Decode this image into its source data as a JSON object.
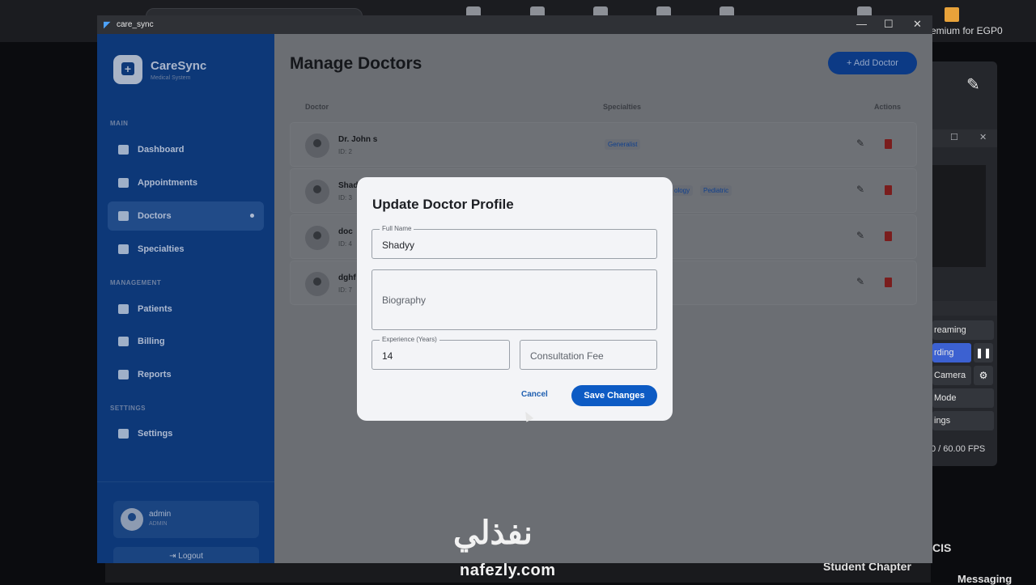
{
  "desktop": {
    "premium_text": "emium for EGP0",
    "obs": {
      "buttons": [
        "reaming",
        "rding",
        "Camera",
        "Mode",
        "ings"
      ],
      "fps": "0 / 60.00 FPS"
    },
    "cis_text": "CIS",
    "student_chapter": "Student Chapter",
    "messaging": "Messaging"
  },
  "window": {
    "title": "care_sync",
    "controls": {
      "minimize": "—",
      "maximize": "☐",
      "close": "✕"
    }
  },
  "sidebar": {
    "brand_name": "CareSync",
    "brand_sub": "Medical System",
    "section_main": "MAIN",
    "section_management": "MANAGEMENT",
    "section_settings": "SETTINGS",
    "items": [
      {
        "label": "Dashboard",
        "icon": "dashboard-icon"
      },
      {
        "label": "Appointments",
        "icon": "calendar-icon"
      },
      {
        "label": "Doctors",
        "icon": "medical-bag-icon",
        "active": true
      },
      {
        "label": "Specialties",
        "icon": "category-icon"
      },
      {
        "label": "Patients",
        "icon": "people-icon"
      },
      {
        "label": "Billing",
        "icon": "card-icon"
      },
      {
        "label": "Reports",
        "icon": "report-icon"
      },
      {
        "label": "Settings",
        "icon": "gear-icon"
      }
    ],
    "user": {
      "name": "admin",
      "role": "ADMIN"
    },
    "logout": "Logout"
  },
  "main": {
    "title": "Manage Doctors",
    "add_button": "Add Doctor",
    "columns": {
      "doctor": "Doctor",
      "specialties": "Specialties",
      "actions": "Actions"
    },
    "rows": [
      {
        "name": "Dr. John s",
        "id": "ID: 2",
        "specialties": [
          "Generalist"
        ]
      },
      {
        "name": "Shad",
        "id": "ID: 3",
        "specialties": [
          "ology",
          "Pediatric"
        ]
      },
      {
        "name": "doc",
        "id": "ID: 4",
        "specialties": []
      },
      {
        "name": "dghf",
        "id": "ID: 7",
        "specialties": []
      }
    ]
  },
  "modal": {
    "title": "Update Doctor Profile",
    "full_name_label": "Full Name",
    "full_name_value": "Shadyy",
    "biography_placeholder": "Biography",
    "experience_label": "Experience (Years)",
    "experience_value": "14",
    "fee_placeholder": "Consultation Fee",
    "cancel": "Cancel",
    "save": "Save Changes"
  },
  "watermark": {
    "arabic": "نفذلي",
    "latin": "nafezly.com"
  },
  "colors": {
    "sidebar": "#0d3878",
    "primary": "#0d5bc4",
    "danger": "#c62828"
  }
}
